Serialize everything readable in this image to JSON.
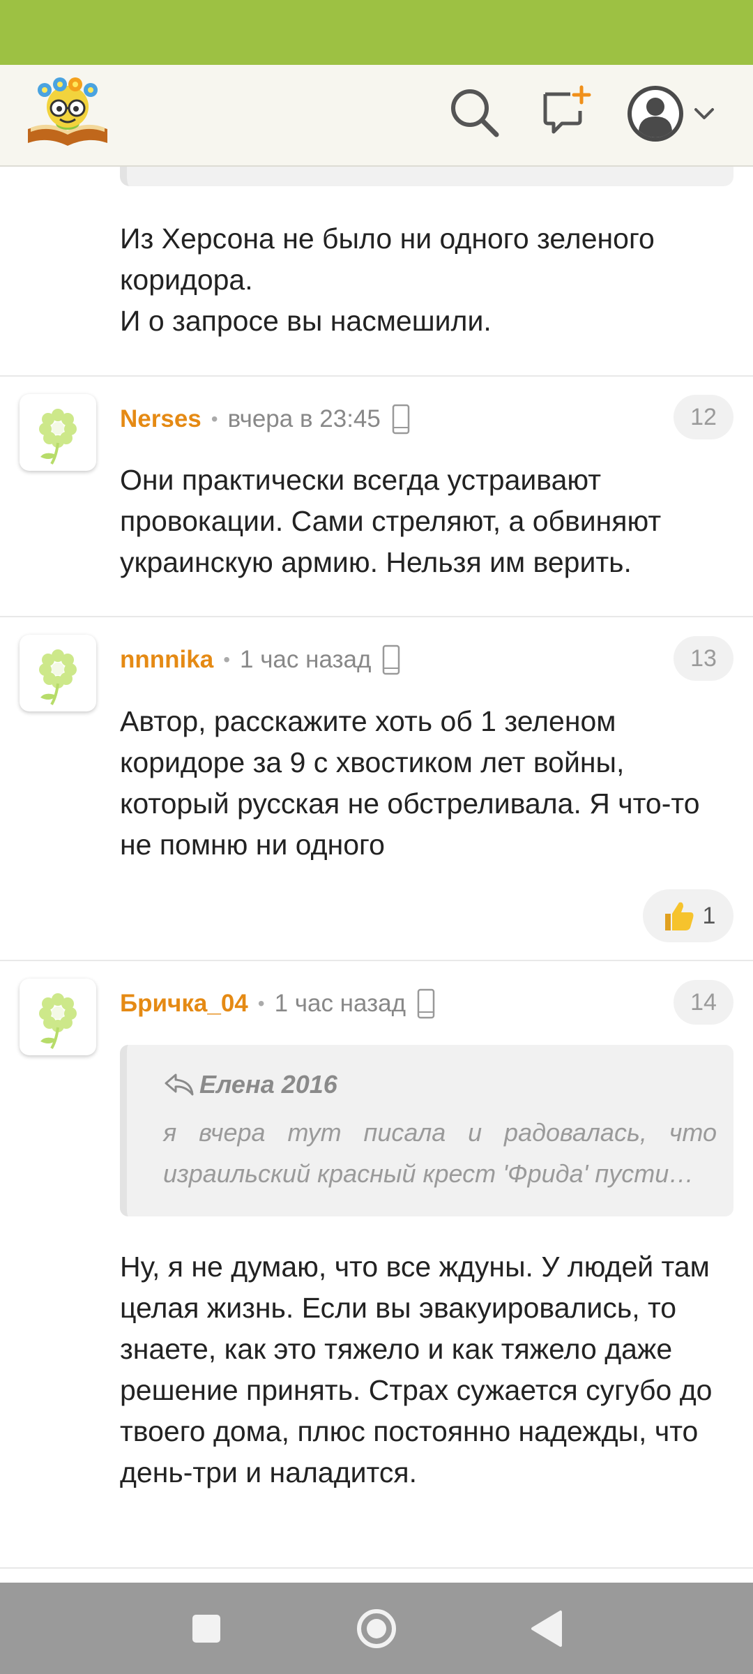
{
  "header": {
    "logo": "smiling-flower-glasses-book-logo",
    "search_icon": "search-icon",
    "new_post_icon": "new-post-icon",
    "profile_icon": "profile-avatar-icon"
  },
  "colors": {
    "status_bar": "#9dc143",
    "header_bg": "#f7f6ef",
    "author": "#e58a14",
    "nav_bar": "#9a9a9a"
  },
  "comments": [
    {
      "text": "Из Херсона не было ни одного зеленого коридора.\nИ о запросе вы насмешили."
    },
    {
      "author": "Nerses",
      "time": "вчера в 23:45",
      "number": "12",
      "text": "Они практически всегда устраивают провокации. Сами стреляют, а обвиняют украинскую армию. Нельзя им верить."
    },
    {
      "author": "nnnnika",
      "time": "1 час назад",
      "number": "13",
      "text": "Автор, расскажите хоть об 1 зеленом коридоре за 9 с хвостиком лет войны, который русская не обстреливала. Я что-то не помню ни одного",
      "likes": "1"
    },
    {
      "author": "Бричка_04",
      "time": "1 час назад",
      "number": "14",
      "quote": {
        "author": "Елена 2016",
        "excerpt": "я вчера тут писала и радовалась, что израильский красный крест 'Фрида' пусти…"
      },
      "text": "Ну, я не думаю, что все ждуны. У людей там целая жизнь. Если вы эвакуировались, то знаете, как это тяжело и как тяжело даже решение принять. Страх сужается сугубо до твоего дома, плюс постоянно надежды, что день-три и наладится."
    }
  ],
  "nav": {
    "recents": "recents-square-icon",
    "home": "home-circle-icon",
    "back": "back-triangle-icon"
  }
}
